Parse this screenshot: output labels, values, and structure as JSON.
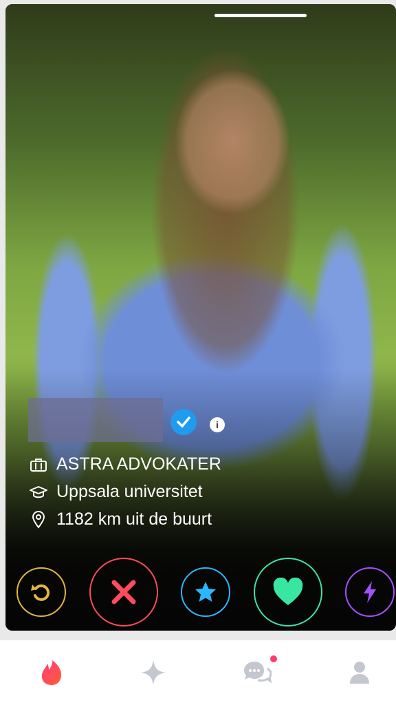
{
  "profile": {
    "name_hidden": "",
    "job": "ASTRA ADVOKATER",
    "school": "Uppsala universitet",
    "distance": "1182 km uit de buurt",
    "verified": true
  },
  "icons": {
    "job": "briefcase-icon",
    "school": "graduation-cap-icon",
    "location": "location-pin-icon",
    "verified": "verified-check-icon",
    "info": "info-icon"
  },
  "actions": [
    {
      "name": "rewind",
      "icon": "rewind-icon",
      "color": "#e2b544"
    },
    {
      "name": "nope",
      "icon": "close-icon",
      "color": "#ff4b5c"
    },
    {
      "name": "super-like",
      "icon": "star-icon",
      "color": "#2ab7ff"
    },
    {
      "name": "like",
      "icon": "heart-icon",
      "color": "#39e6a1"
    },
    {
      "name": "boost",
      "icon": "lightning-icon",
      "color": "#a351ff"
    }
  ],
  "nav": [
    {
      "name": "discover",
      "icon": "flame-icon",
      "active": true
    },
    {
      "name": "explore",
      "icon": "sparkle-icon",
      "active": false
    },
    {
      "name": "messages",
      "icon": "chat-icon",
      "active": false,
      "badge": true
    },
    {
      "name": "profile",
      "icon": "user-icon",
      "active": false
    }
  ],
  "info_glyph": "i"
}
